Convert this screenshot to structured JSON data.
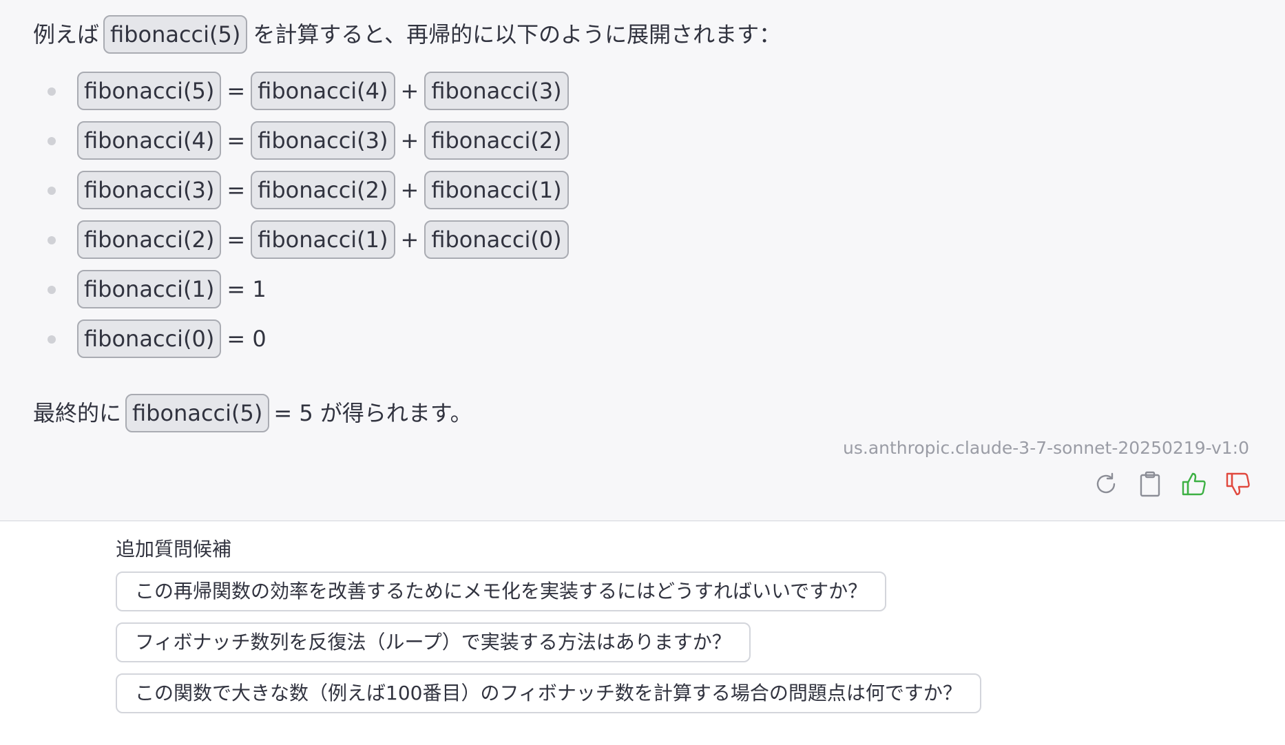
{
  "message": {
    "intro": {
      "before": "例えば",
      "code": "fibonacci(5)",
      "after": "を計算すると、再帰的に以下のように展開されます："
    },
    "expansions": [
      {
        "lhs": "fibonacci(5)",
        "eq": "=",
        "a": "fibonacci(4)",
        "plus": "+",
        "b": "fibonacci(3)"
      },
      {
        "lhs": "fibonacci(4)",
        "eq": "=",
        "a": "fibonacci(3)",
        "plus": "+",
        "b": "fibonacci(2)"
      },
      {
        "lhs": "fibonacci(3)",
        "eq": "=",
        "a": "fibonacci(2)",
        "plus": "+",
        "b": "fibonacci(1)"
      },
      {
        "lhs": "fibonacci(2)",
        "eq": "=",
        "a": "fibonacci(1)",
        "plus": "+",
        "b": "fibonacci(0)"
      }
    ],
    "base_cases": [
      {
        "lhs": "fibonacci(1)",
        "value": "= 1"
      },
      {
        "lhs": "fibonacci(0)",
        "value": "= 0"
      }
    ],
    "conclusion": {
      "before": "最終的に",
      "code": "fibonacci(5)",
      "after": "= 5 が得られます。"
    },
    "model": "us.anthropic.claude-3-7-sonnet-20250219-v1:0"
  },
  "actions": {
    "icons": [
      "refresh-icon",
      "clipboard-icon",
      "thumbs-up-icon",
      "thumbs-down-icon"
    ],
    "colors": {
      "neutral": "#8b8d96",
      "like": "#3cb043",
      "dislike": "#e0483e"
    }
  },
  "suggestions": {
    "title": "追加質問候補",
    "items": [
      "この再帰関数の効率を改善するためにメモ化を実装するにはどうすればいいですか？",
      "フィボナッチ数列を反復法（ループ）で実装する方法はありますか？",
      "この関数で大きな数（例えば100番目）のフィボナッチ数を計算する場合の問題点は何ですか？"
    ]
  }
}
